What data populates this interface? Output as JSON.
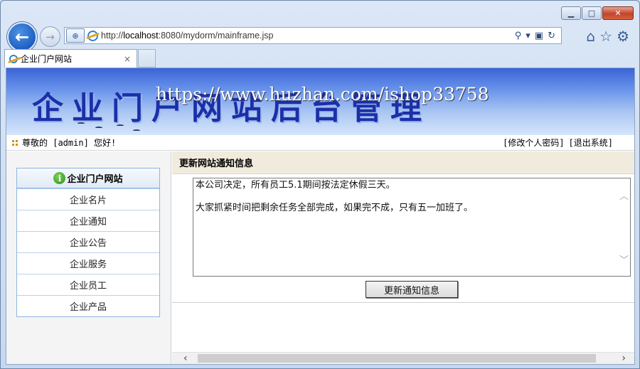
{
  "browser": {
    "address": {
      "scheme": "http://",
      "host": "localhost",
      "rest": ":8080/mydorm/mainframe.jsp"
    },
    "tab": {
      "title": "企业门户网站",
      "close": "×"
    },
    "controls": {
      "minimize": "▁",
      "maximize": "□",
      "close": "✕"
    },
    "icons": [
      "home-icon",
      "favorites-star-icon",
      "settings-gear-icon"
    ]
  },
  "banner": {
    "title": "企业门户网站后台管理",
    "watermark": "https://www.huzhan.com/ishop33758"
  },
  "userbar": {
    "greeting": "尊敬的 [admin] 您好!",
    "change_password": "[修改个人密码]",
    "logout": "[退出系统]"
  },
  "sidebar": {
    "header": "企业门户网站",
    "items": [
      {
        "label": "企业名片"
      },
      {
        "label": "企业通知"
      },
      {
        "label": "企业公告"
      },
      {
        "label": "企业服务"
      },
      {
        "label": "企业员工"
      },
      {
        "label": "企业产品"
      }
    ]
  },
  "main": {
    "title": "更新网站通知信息",
    "notice_text": "本公司决定，所有员工5.1期间按法定休假三天。\n\n大家抓紧时间把剩余任务全部完成，如果完不成，只有五一加班了。",
    "update_button": "更新通知信息"
  },
  "colors": {
    "banner_title": "#1c2fa8",
    "panel_title_bg": "#f1ebdd",
    "menu_border": "#8fb6df"
  }
}
